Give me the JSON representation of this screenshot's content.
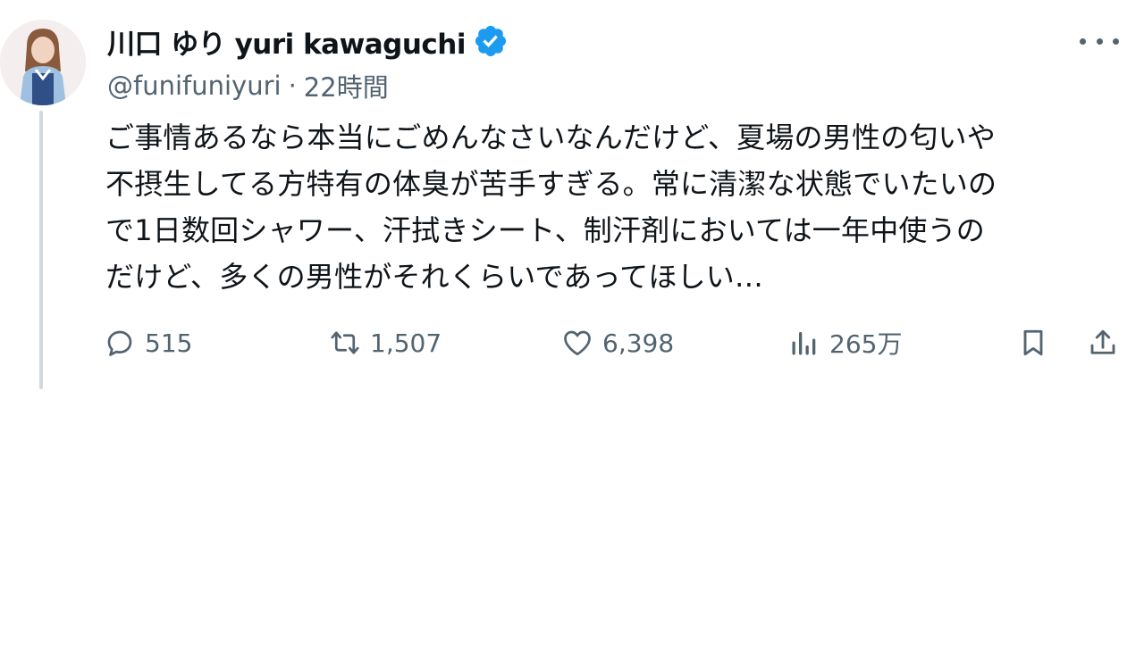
{
  "tweet": {
    "display_name": "川口 ゆり yuri kawaguchi",
    "handle": "@funifuniyuri",
    "separator": "·",
    "time": "22時間",
    "text_lines": [
      "ご事情あるなら本当にごめんなさいなんだけど、夏場の男性の匂いや",
      "不摂生してる方特有の体臭が苦手すぎる。常に清潔な状態でいたいの",
      "で1日数回シャワー、汗拭きシート、制汗剤においては一年中使うの",
      "だけど、多くの男性がそれくらいであってほしい…"
    ]
  },
  "actions": {
    "replies": "515",
    "retweets": "1,507",
    "likes": "6,398",
    "views": "265万"
  },
  "icons": {
    "verified": "verified-badge-icon",
    "more": "more-dots-icon",
    "reply": "reply-icon",
    "retweet": "retweet-icon",
    "like": "heart-icon",
    "views": "views-chart-icon",
    "bookmark": "bookmark-icon",
    "share": "share-icon"
  },
  "colors": {
    "text": "#0f1419",
    "secondary": "#536471",
    "verified": "#1d9bf0",
    "thread_line": "#cfd9de"
  }
}
